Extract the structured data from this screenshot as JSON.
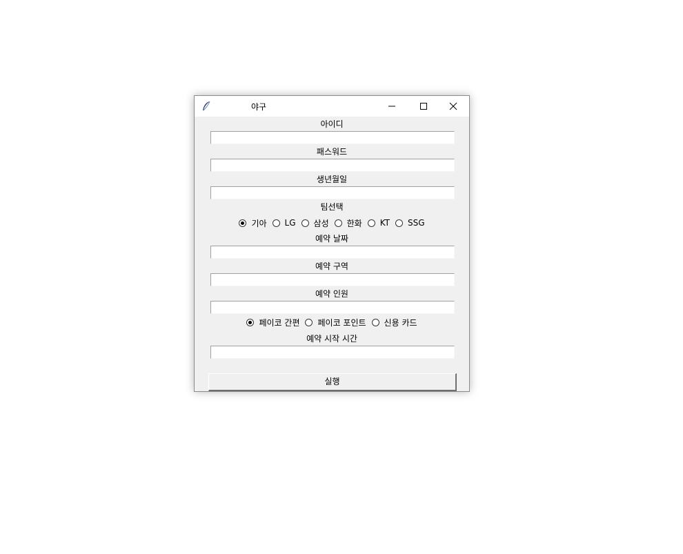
{
  "window": {
    "title": "야구"
  },
  "fields": {
    "id": {
      "label": "아이디",
      "value": ""
    },
    "password": {
      "label": "패스워드",
      "value": ""
    },
    "birth": {
      "label": "생년월일",
      "value": ""
    },
    "team_label": "팀선택",
    "teams": [
      "기아",
      "LG",
      "삼성",
      "한화",
      "KT",
      "SSG"
    ],
    "team_selected": "기아",
    "date": {
      "label": "예약 날짜",
      "value": ""
    },
    "section": {
      "label": "예약 구역",
      "value": ""
    },
    "people": {
      "label": "예약 인원",
      "value": ""
    },
    "payments": [
      "페이코 간편",
      "페이코 포인트",
      "신용 카드"
    ],
    "payment_selected": "페이코 간편",
    "start_time": {
      "label": "예약 시작 시간",
      "value": ""
    }
  },
  "run_button": "실행",
  "icons": {
    "app": "feather-icon",
    "minimize": "minimize-icon",
    "maximize": "maximize-icon",
    "close": "close-icon"
  }
}
